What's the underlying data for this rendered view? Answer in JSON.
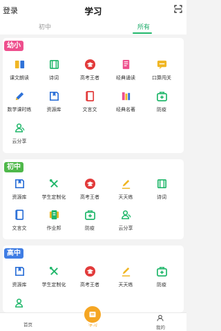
{
  "header": {
    "login_label": "登录",
    "title": "学习"
  },
  "tabs": [
    {
      "label": "初中"
    },
    {
      "label": "所有"
    }
  ],
  "sections": {
    "kindergarten": {
      "badge": "幼小",
      "items": [
        {
          "label": "课文朗读"
        },
        {
          "label": "诗词"
        },
        {
          "label": "高考王者"
        },
        {
          "label": "经典诵读"
        },
        {
          "label": "口算闯关"
        },
        {
          "label": "数学课时练"
        },
        {
          "label": "资源库"
        },
        {
          "label": "文言文"
        },
        {
          "label": "经典名著"
        },
        {
          "label": "防疫"
        },
        {
          "label": "云分享"
        }
      ]
    },
    "junior": {
      "badge": "初中",
      "items": [
        {
          "label": "资源库"
        },
        {
          "label": "学生定制化"
        },
        {
          "label": "高考王者"
        },
        {
          "label": "天天练"
        },
        {
          "label": "诗词"
        },
        {
          "label": "文言文"
        },
        {
          "label": "作业邦"
        },
        {
          "label": "防疫"
        },
        {
          "label": "云分享"
        }
      ]
    },
    "senior": {
      "badge": "高中",
      "items": [
        {
          "label": "资源库"
        },
        {
          "label": "学生定制化"
        },
        {
          "label": "高考王者"
        },
        {
          "label": "天天练"
        },
        {
          "label": "防疫"
        }
      ]
    }
  },
  "bottom_nav": {
    "left_label": "首页",
    "center_label": "学习",
    "right_label": "我的"
  },
  "colors": {
    "green": "#21b76b",
    "pink": "#ee4f8d",
    "blue": "#3f7de4",
    "orange": "#f5a623",
    "red": "#e23b3b"
  }
}
